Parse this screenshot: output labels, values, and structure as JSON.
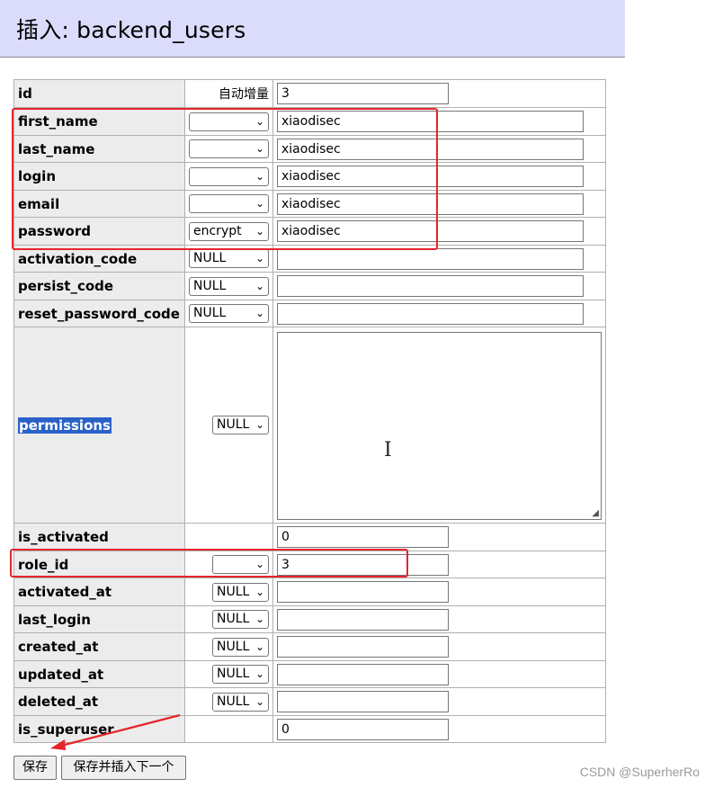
{
  "page": {
    "title": "插入: backend_users"
  },
  "rows": [
    {
      "field": "id",
      "function": "自动增量",
      "value": "3",
      "input": "narrow"
    },
    {
      "field": "first_name",
      "function": "",
      "value": "xiaodisec",
      "input": "wide"
    },
    {
      "field": "last_name",
      "function": "",
      "value": "xiaodisec",
      "input": "wide"
    },
    {
      "field": "login",
      "function": "",
      "value": "xiaodisec",
      "input": "wide"
    },
    {
      "field": "email",
      "function": "",
      "value": "xiaodisec",
      "input": "wide"
    },
    {
      "field": "password",
      "function": "encrypt",
      "value": "xiaodisec",
      "input": "wide"
    },
    {
      "field": "activation_code",
      "function": "NULL",
      "value": "",
      "input": "wide"
    },
    {
      "field": "persist_code",
      "function": "NULL",
      "value": "",
      "input": "wide"
    },
    {
      "field": "reset_password_code",
      "function": "NULL",
      "value": "",
      "input": "wide"
    },
    {
      "field": "permissions",
      "function": "NULL",
      "value": "",
      "input": "textarea"
    },
    {
      "field": "is_activated",
      "function": "",
      "value": "0",
      "input": "narrow"
    },
    {
      "field": "role_id",
      "function": "",
      "value": "3",
      "input": "narrow"
    },
    {
      "field": "activated_at",
      "function": "NULL",
      "value": "",
      "input": "narrow"
    },
    {
      "field": "last_login",
      "function": "NULL",
      "value": "",
      "input": "narrow"
    },
    {
      "field": "created_at",
      "function": "NULL",
      "value": "",
      "input": "narrow"
    },
    {
      "field": "updated_at",
      "function": "NULL",
      "value": "",
      "input": "narrow"
    },
    {
      "field": "deleted_at",
      "function": "NULL",
      "value": "",
      "input": "narrow"
    },
    {
      "field": "is_superuser",
      "function": "",
      "value": "0",
      "input": "narrow"
    }
  ],
  "buttons": {
    "save": "保存",
    "save_and_next": "保存并插入下一个"
  },
  "watermark": "CSDN @SuperherRo",
  "icons": {
    "dropdown": "chevron-down-icon",
    "resize": "resize-handle-icon",
    "cursor": "text-cursor-icon"
  },
  "colors": {
    "header_bg": "#dbdcfb",
    "annotation_red": "#e5262b",
    "selection_blue": "#2a61c8"
  }
}
